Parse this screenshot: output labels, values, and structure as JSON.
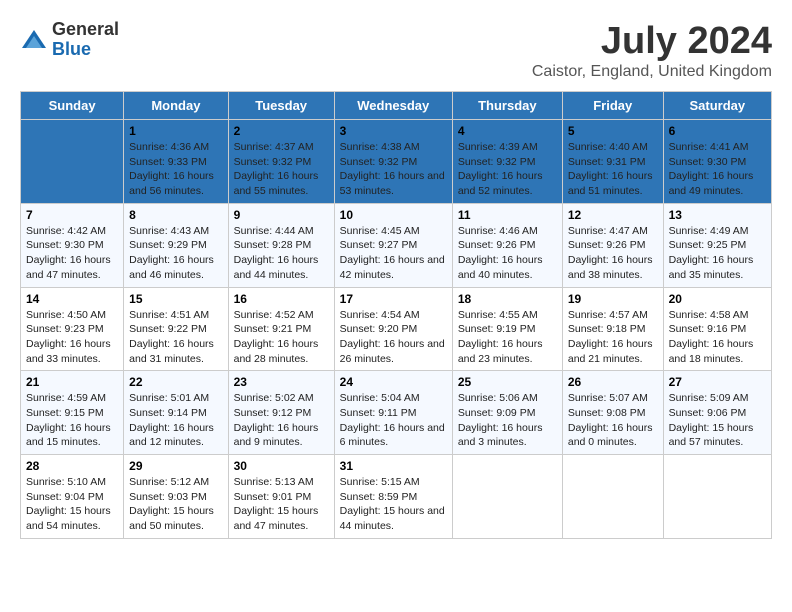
{
  "logo": {
    "general": "General",
    "blue": "Blue"
  },
  "title": "July 2024",
  "subtitle": "Caistor, England, United Kingdom",
  "columns": [
    "Sunday",
    "Monday",
    "Tuesday",
    "Wednesday",
    "Thursday",
    "Friday",
    "Saturday"
  ],
  "weeks": [
    [
      {
        "day": "",
        "sunrise": "",
        "sunset": "",
        "daylight": ""
      },
      {
        "day": "1",
        "sunrise": "Sunrise: 4:36 AM",
        "sunset": "Sunset: 9:33 PM",
        "daylight": "Daylight: 16 hours and 56 minutes."
      },
      {
        "day": "2",
        "sunrise": "Sunrise: 4:37 AM",
        "sunset": "Sunset: 9:32 PM",
        "daylight": "Daylight: 16 hours and 55 minutes."
      },
      {
        "day": "3",
        "sunrise": "Sunrise: 4:38 AM",
        "sunset": "Sunset: 9:32 PM",
        "daylight": "Daylight: 16 hours and 53 minutes."
      },
      {
        "day": "4",
        "sunrise": "Sunrise: 4:39 AM",
        "sunset": "Sunset: 9:32 PM",
        "daylight": "Daylight: 16 hours and 52 minutes."
      },
      {
        "day": "5",
        "sunrise": "Sunrise: 4:40 AM",
        "sunset": "Sunset: 9:31 PM",
        "daylight": "Daylight: 16 hours and 51 minutes."
      },
      {
        "day": "6",
        "sunrise": "Sunrise: 4:41 AM",
        "sunset": "Sunset: 9:30 PM",
        "daylight": "Daylight: 16 hours and 49 minutes."
      }
    ],
    [
      {
        "day": "7",
        "sunrise": "Sunrise: 4:42 AM",
        "sunset": "Sunset: 9:30 PM",
        "daylight": "Daylight: 16 hours and 47 minutes."
      },
      {
        "day": "8",
        "sunrise": "Sunrise: 4:43 AM",
        "sunset": "Sunset: 9:29 PM",
        "daylight": "Daylight: 16 hours and 46 minutes."
      },
      {
        "day": "9",
        "sunrise": "Sunrise: 4:44 AM",
        "sunset": "Sunset: 9:28 PM",
        "daylight": "Daylight: 16 hours and 44 minutes."
      },
      {
        "day": "10",
        "sunrise": "Sunrise: 4:45 AM",
        "sunset": "Sunset: 9:27 PM",
        "daylight": "Daylight: 16 hours and 42 minutes."
      },
      {
        "day": "11",
        "sunrise": "Sunrise: 4:46 AM",
        "sunset": "Sunset: 9:26 PM",
        "daylight": "Daylight: 16 hours and 40 minutes."
      },
      {
        "day": "12",
        "sunrise": "Sunrise: 4:47 AM",
        "sunset": "Sunset: 9:26 PM",
        "daylight": "Daylight: 16 hours and 38 minutes."
      },
      {
        "day": "13",
        "sunrise": "Sunrise: 4:49 AM",
        "sunset": "Sunset: 9:25 PM",
        "daylight": "Daylight: 16 hours and 35 minutes."
      }
    ],
    [
      {
        "day": "14",
        "sunrise": "Sunrise: 4:50 AM",
        "sunset": "Sunset: 9:23 PM",
        "daylight": "Daylight: 16 hours and 33 minutes."
      },
      {
        "day": "15",
        "sunrise": "Sunrise: 4:51 AM",
        "sunset": "Sunset: 9:22 PM",
        "daylight": "Daylight: 16 hours and 31 minutes."
      },
      {
        "day": "16",
        "sunrise": "Sunrise: 4:52 AM",
        "sunset": "Sunset: 9:21 PM",
        "daylight": "Daylight: 16 hours and 28 minutes."
      },
      {
        "day": "17",
        "sunrise": "Sunrise: 4:54 AM",
        "sunset": "Sunset: 9:20 PM",
        "daylight": "Daylight: 16 hours and 26 minutes."
      },
      {
        "day": "18",
        "sunrise": "Sunrise: 4:55 AM",
        "sunset": "Sunset: 9:19 PM",
        "daylight": "Daylight: 16 hours and 23 minutes."
      },
      {
        "day": "19",
        "sunrise": "Sunrise: 4:57 AM",
        "sunset": "Sunset: 9:18 PM",
        "daylight": "Daylight: 16 hours and 21 minutes."
      },
      {
        "day": "20",
        "sunrise": "Sunrise: 4:58 AM",
        "sunset": "Sunset: 9:16 PM",
        "daylight": "Daylight: 16 hours and 18 minutes."
      }
    ],
    [
      {
        "day": "21",
        "sunrise": "Sunrise: 4:59 AM",
        "sunset": "Sunset: 9:15 PM",
        "daylight": "Daylight: 16 hours and 15 minutes."
      },
      {
        "day": "22",
        "sunrise": "Sunrise: 5:01 AM",
        "sunset": "Sunset: 9:14 PM",
        "daylight": "Daylight: 16 hours and 12 minutes."
      },
      {
        "day": "23",
        "sunrise": "Sunrise: 5:02 AM",
        "sunset": "Sunset: 9:12 PM",
        "daylight": "Daylight: 16 hours and 9 minutes."
      },
      {
        "day": "24",
        "sunrise": "Sunrise: 5:04 AM",
        "sunset": "Sunset: 9:11 PM",
        "daylight": "Daylight: 16 hours and 6 minutes."
      },
      {
        "day": "25",
        "sunrise": "Sunrise: 5:06 AM",
        "sunset": "Sunset: 9:09 PM",
        "daylight": "Daylight: 16 hours and 3 minutes."
      },
      {
        "day": "26",
        "sunrise": "Sunrise: 5:07 AM",
        "sunset": "Sunset: 9:08 PM",
        "daylight": "Daylight: 16 hours and 0 minutes."
      },
      {
        "day": "27",
        "sunrise": "Sunrise: 5:09 AM",
        "sunset": "Sunset: 9:06 PM",
        "daylight": "Daylight: 15 hours and 57 minutes."
      }
    ],
    [
      {
        "day": "28",
        "sunrise": "Sunrise: 5:10 AM",
        "sunset": "Sunset: 9:04 PM",
        "daylight": "Daylight: 15 hours and 54 minutes."
      },
      {
        "day": "29",
        "sunrise": "Sunrise: 5:12 AM",
        "sunset": "Sunset: 9:03 PM",
        "daylight": "Daylight: 15 hours and 50 minutes."
      },
      {
        "day": "30",
        "sunrise": "Sunrise: 5:13 AM",
        "sunset": "Sunset: 9:01 PM",
        "daylight": "Daylight: 15 hours and 47 minutes."
      },
      {
        "day": "31",
        "sunrise": "Sunrise: 5:15 AM",
        "sunset": "Sunset: 8:59 PM",
        "daylight": "Daylight: 15 hours and 44 minutes."
      },
      {
        "day": "",
        "sunrise": "",
        "sunset": "",
        "daylight": ""
      },
      {
        "day": "",
        "sunrise": "",
        "sunset": "",
        "daylight": ""
      },
      {
        "day": "",
        "sunrise": "",
        "sunset": "",
        "daylight": ""
      }
    ]
  ]
}
